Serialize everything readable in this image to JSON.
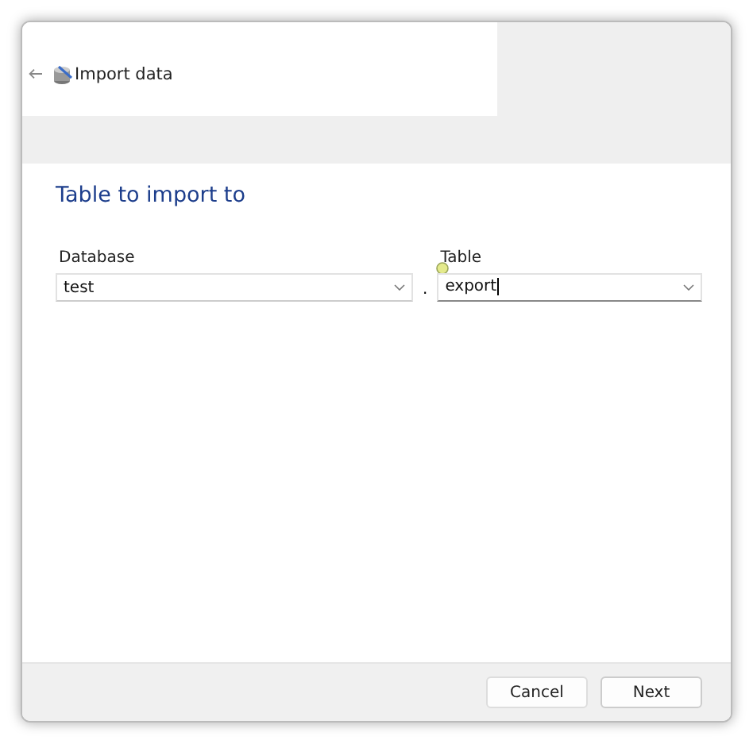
{
  "window": {
    "title": "Import data"
  },
  "heading": "Table to import to",
  "fields": [
    {
      "label": "Database",
      "value": "test",
      "focused": false
    },
    {
      "label": "Table",
      "value": "export",
      "focused": true
    }
  ],
  "separator": ".",
  "buttons": [
    {
      "label": "Cancel",
      "default": false
    },
    {
      "label": "Next",
      "default": true
    }
  ]
}
